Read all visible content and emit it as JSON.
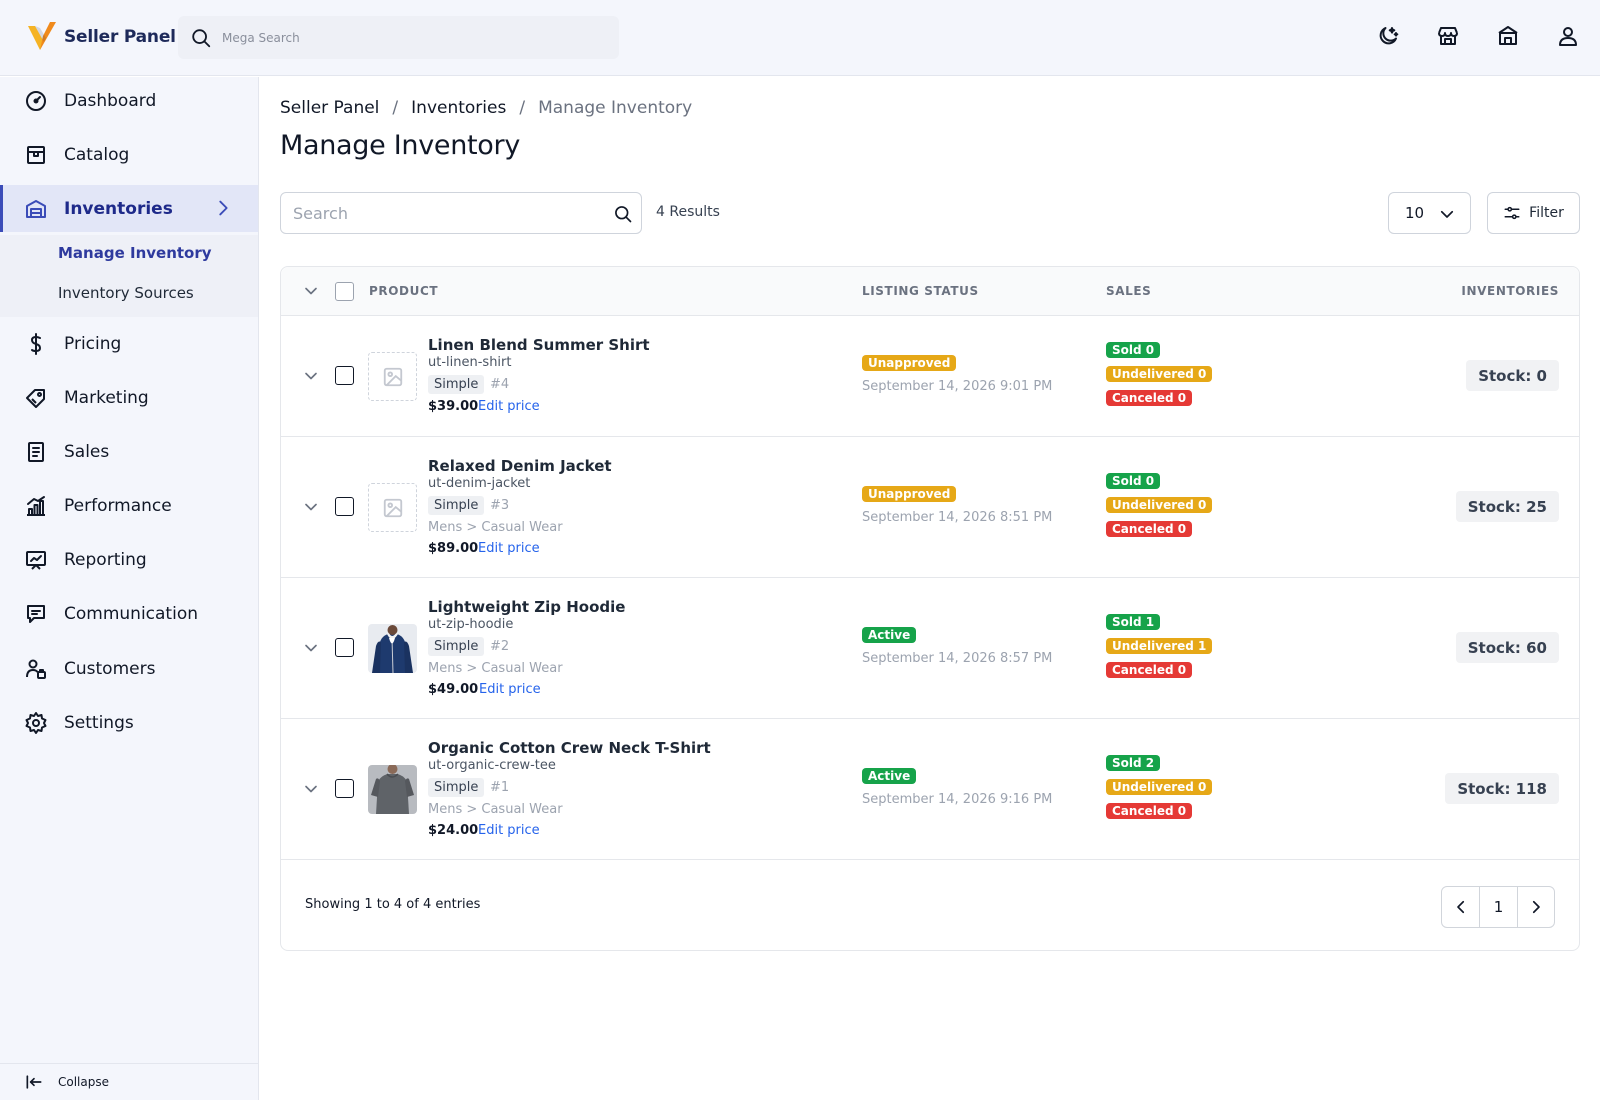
{
  "app": {
    "title": "Seller Panel"
  },
  "header": {
    "search_placeholder": "Mega Search",
    "icons": [
      "moon-icon",
      "store-icon",
      "bank-icon",
      "user-icon"
    ]
  },
  "sidebar": {
    "items": [
      {
        "label": "Dashboard",
        "icon": "dashboard-icon"
      },
      {
        "label": "Catalog",
        "icon": "catalog-icon"
      },
      {
        "label": "Inventories",
        "icon": "warehouse-icon",
        "active": true
      },
      {
        "label": "Pricing",
        "icon": "dollar-icon"
      },
      {
        "label": "Marketing",
        "icon": "tag-icon"
      },
      {
        "label": "Sales",
        "icon": "receipt-icon"
      },
      {
        "label": "Performance",
        "icon": "chart-icon"
      },
      {
        "label": "Reporting",
        "icon": "report-icon"
      },
      {
        "label": "Communication",
        "icon": "message-icon"
      },
      {
        "label": "Customers",
        "icon": "customers-icon"
      },
      {
        "label": "Settings",
        "icon": "settings-icon"
      }
    ],
    "subitems": [
      {
        "label": "Manage Inventory",
        "active": true
      },
      {
        "label": "Inventory Sources"
      }
    ],
    "collapse_label": "Collapse"
  },
  "breadcrumb": [
    "Seller Panel",
    "Inventories",
    "Manage Inventory"
  ],
  "page": {
    "title": "Manage Inventory"
  },
  "toolbar": {
    "search_placeholder": "Search",
    "results": "4 Results",
    "per_page": "10",
    "filter_label": "Filter"
  },
  "table": {
    "headers": {
      "product": "PRODUCT",
      "listing_status": "LISTING STATUS",
      "sales": "SALES",
      "inventories": "INVENTORIES"
    },
    "edit_price_label": "Edit price",
    "rows": [
      {
        "name": "Linen Blend Summer Shirt",
        "sku": "ut-linen-shirt",
        "type": "Simple",
        "number": "#4",
        "category": "",
        "price": "$39.00",
        "thumb": "placeholder",
        "status": "Unapproved",
        "date": "September 14, 2026 9:01 PM",
        "sold": "Sold 0",
        "undelivered": "Undelivered 0",
        "canceled": "Canceled 0",
        "stock": "Stock: 0"
      },
      {
        "name": "Relaxed Denim Jacket",
        "sku": "ut-denim-jacket",
        "type": "Simple",
        "number": "#3",
        "category": "Mens > Casual Wear",
        "price": "$89.00",
        "thumb": "placeholder",
        "status": "Unapproved",
        "date": "September 14, 2026 8:51 PM",
        "sold": "Sold 0",
        "undelivered": "Undelivered 0",
        "canceled": "Canceled 0",
        "stock": "Stock: 25"
      },
      {
        "name": "Lightweight Zip Hoodie",
        "sku": "ut-zip-hoodie",
        "type": "Simple",
        "number": "#2",
        "category": "Mens > Casual Wear",
        "price": "$49.00",
        "thumb": "hoodie",
        "status": "Active",
        "date": "September 14, 2026 8:57 PM",
        "sold": "Sold 1",
        "undelivered": "Undelivered 1",
        "canceled": "Canceled 0",
        "stock": "Stock: 60"
      },
      {
        "name": "Organic Cotton Crew Neck T-Shirt",
        "sku": "ut-organic-crew-tee",
        "type": "Simple",
        "number": "#1",
        "category": "Mens > Casual Wear",
        "price": "$24.00",
        "thumb": "tshirt",
        "status": "Active",
        "date": "September 14, 2026 9:16 PM",
        "sold": "Sold 2",
        "undelivered": "Undelivered 0",
        "canceled": "Canceled 0",
        "stock": "Stock: 118"
      }
    ]
  },
  "footer": {
    "showing": "Showing 1 to 4 of 4 entries",
    "current_page": "1"
  }
}
